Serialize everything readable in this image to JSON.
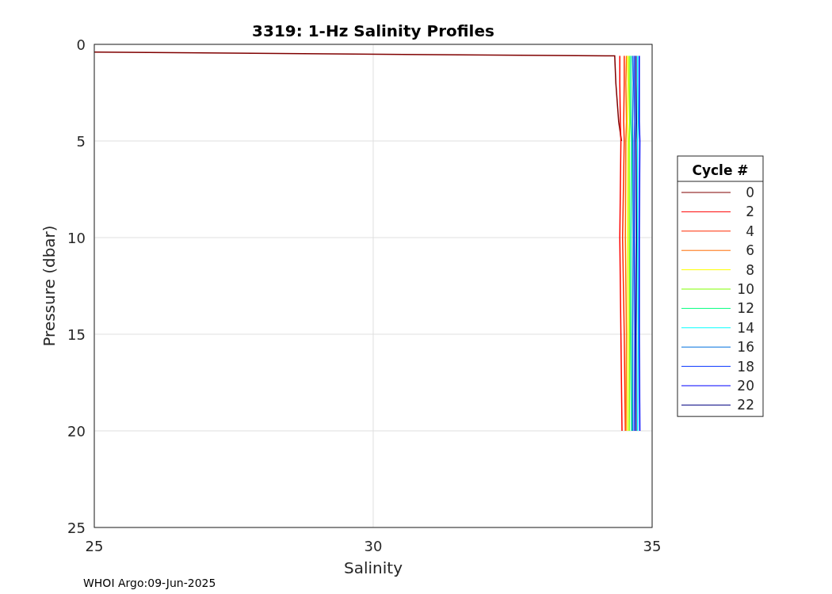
{
  "figure": {
    "chart_data": {
      "type": "line",
      "orientation": "horizontal",
      "title": "3319: 1-Hz Salinity Profiles",
      "xlabel": "Salinity",
      "ylabel": "Pressure (dbar)",
      "xlim": [
        25,
        35
      ],
      "ylim": [
        25,
        0
      ],
      "xticks": [
        25,
        30,
        35
      ],
      "yticks": [
        0,
        5,
        10,
        15,
        20,
        25
      ],
      "grid": true,
      "legend": {
        "title": "Cycle #"
      },
      "x": [
        0.4,
        0.6,
        2,
        4,
        5,
        10,
        15,
        20
      ],
      "series": [
        {
          "name": "0",
          "color": "#800000",
          "values": [
            25,
            34.33,
            34.35,
            34.4,
            34.45,
            null,
            null,
            null
          ]
        },
        {
          "name": "2",
          "color": "#ff0000",
          "values": [
            null,
            34.42,
            34.42,
            34.43,
            34.44,
            34.42,
            34.44,
            34.46
          ]
        },
        {
          "name": "4",
          "color": "#ff2a00",
          "values": [
            null,
            34.5,
            34.5,
            34.49,
            34.5,
            34.47,
            34.5,
            34.52
          ]
        },
        {
          "name": "6",
          "color": "#ff6a00",
          "values": [
            null,
            34.54,
            34.53,
            34.54,
            34.53,
            34.52,
            34.54,
            34.53
          ]
        },
        {
          "name": "8",
          "color": "#ffff00",
          "values": [
            null,
            34.56,
            34.57,
            34.56,
            34.57,
            34.56,
            34.57,
            34.56
          ]
        },
        {
          "name": "10",
          "color": "#80ff00",
          "values": [
            null,
            34.59,
            34.59,
            34.6,
            34.59,
            34.59,
            34.6,
            34.59
          ]
        },
        {
          "name": "12",
          "color": "#00ff80",
          "values": [
            null,
            34.62,
            34.62,
            34.62,
            34.63,
            34.62,
            34.62,
            34.63
          ]
        },
        {
          "name": "14",
          "color": "#00ffff",
          "values": [
            null,
            34.74,
            34.74,
            34.75,
            34.74,
            34.74,
            34.75,
            34.74
          ]
        },
        {
          "name": "16",
          "color": "#0070dd",
          "values": [
            null,
            34.65,
            34.66,
            34.65,
            34.65,
            34.66,
            34.65,
            34.65
          ]
        },
        {
          "name": "18",
          "color": "#0030ff",
          "values": [
            null,
            34.68,
            34.68,
            34.69,
            34.68,
            34.68,
            34.69,
            34.68
          ]
        },
        {
          "name": "20",
          "color": "#0000ff",
          "values": [
            null,
            34.77,
            34.77,
            34.77,
            34.78,
            34.77,
            34.77,
            34.78
          ]
        },
        {
          "name": "22",
          "color": "#000080",
          "values": [
            null,
            34.71,
            34.71,
            34.72,
            34.71,
            34.72,
            34.71,
            34.71
          ]
        }
      ]
    },
    "footer": "WHOI Argo:09-Jun-2025"
  }
}
